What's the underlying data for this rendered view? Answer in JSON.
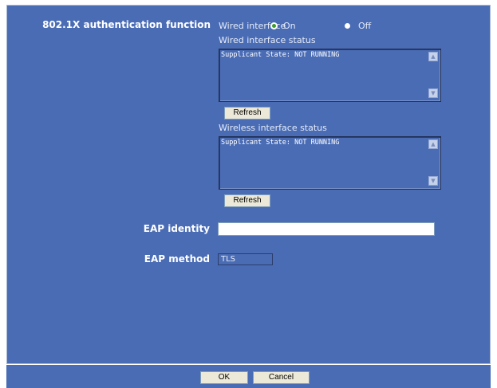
{
  "auth": {
    "label": "802.1X authentication function",
    "wired_interface_label": "Wired interface",
    "option_on": "On",
    "option_off": "Off",
    "selected": "On"
  },
  "wired_status": {
    "heading": "Wired interface status",
    "text": "Supplicant State: NOT RUNNING",
    "refresh_label": "Refresh"
  },
  "wireless_status": {
    "heading": "Wireless interface status",
    "text": "Supplicant State: NOT RUNNING",
    "refresh_label": "Refresh"
  },
  "eap_identity": {
    "label": "EAP identity",
    "value": ""
  },
  "eap_method": {
    "label": "EAP method",
    "value": "TLS"
  },
  "footer": {
    "ok_label": "OK",
    "cancel_label": "Cancel"
  },
  "colors": {
    "panel_bg": "#4a6cb5",
    "radio_selected": "#3d9a2b"
  }
}
